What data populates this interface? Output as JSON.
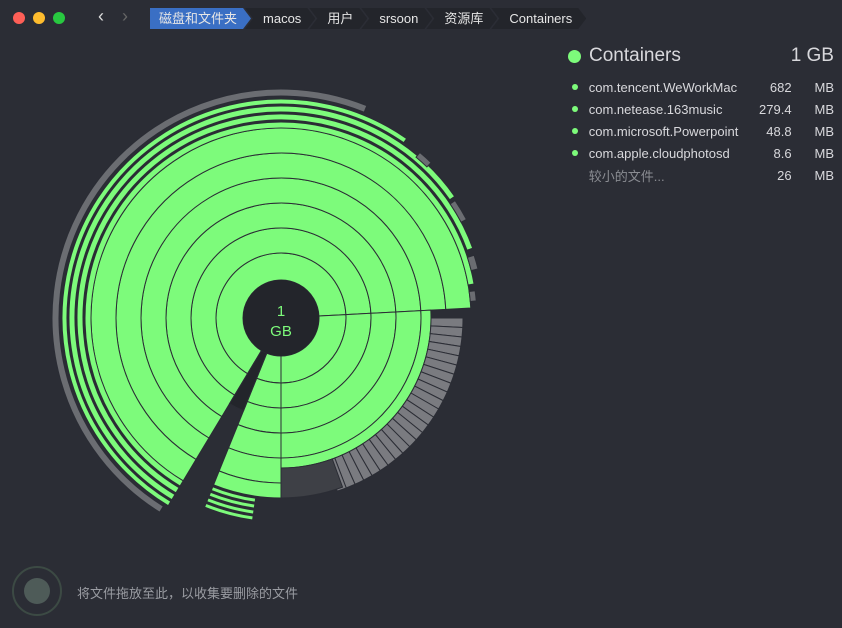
{
  "window": {
    "traffic_lights": [
      "#fe5f57",
      "#febc2e",
      "#28c840"
    ]
  },
  "breadcrumb": [
    "磁盘和文件夹",
    "macos",
    "用户",
    "srsoon",
    "资源库",
    "Containers"
  ],
  "panel": {
    "title": "Containers",
    "size": "1 GB",
    "items": [
      {
        "name": "com.tencent.WeWorkMac",
        "value": "682",
        "unit": "MB"
      },
      {
        "name": "com.netease.163music",
        "value": "279.4",
        "unit": "MB"
      },
      {
        "name": "com.microsoft.Powerpoint",
        "value": "48.8",
        "unit": "MB"
      },
      {
        "name": "com.apple.cloudphotosd",
        "value": "8.6",
        "unit": "MB"
      },
      {
        "name": "较小的文件...",
        "value": "26",
        "unit": "MB"
      }
    ]
  },
  "center": {
    "value": "1",
    "unit": "GB"
  },
  "drop_zone": {
    "text": "将文件拖放至此，以收集要删除的文件"
  },
  "colors": {
    "accent": "#7dfb7b",
    "breadcrumb_active": "#3a6fc4",
    "background": "#2b2d35"
  }
}
